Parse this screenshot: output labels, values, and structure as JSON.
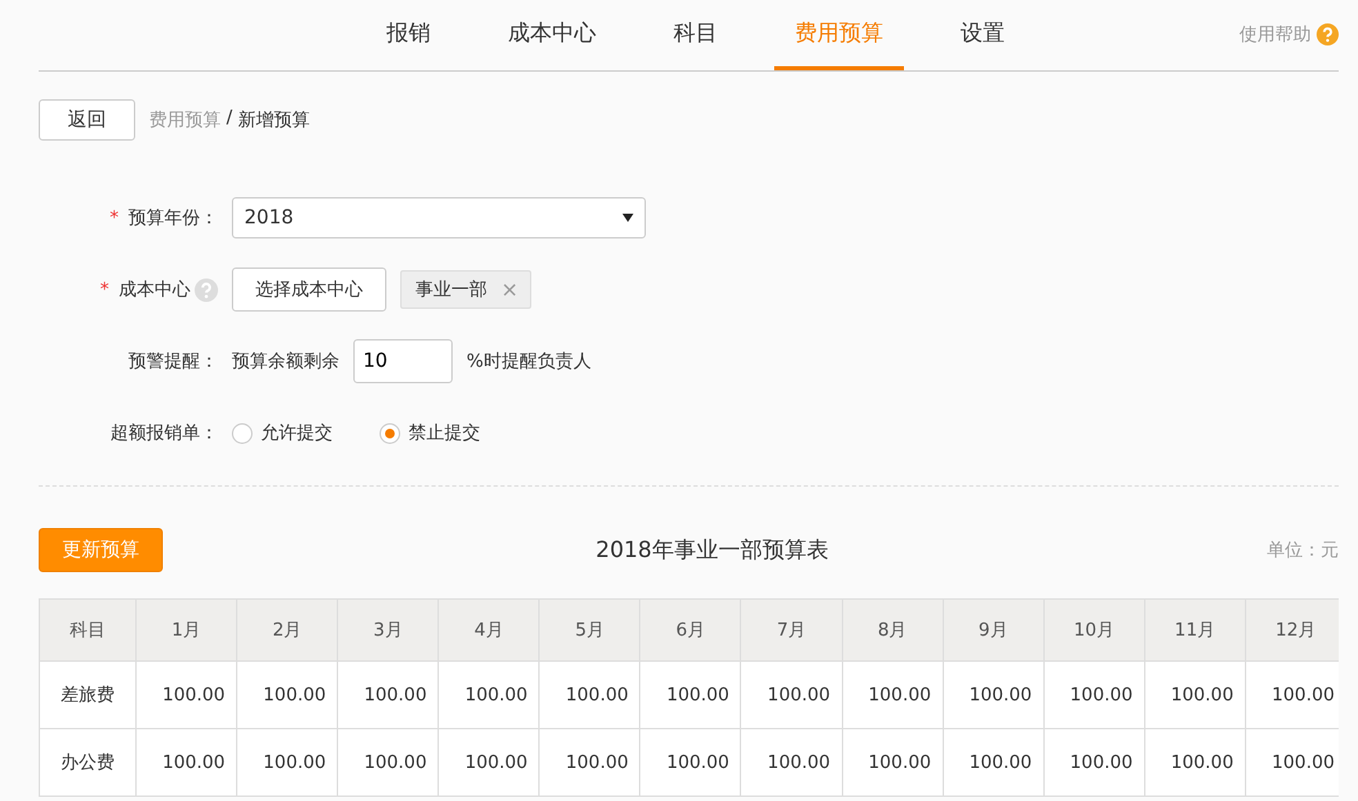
{
  "nav": {
    "tabs": [
      {
        "label": "报销",
        "selected": false
      },
      {
        "label": "成本中心",
        "selected": false
      },
      {
        "label": "科目",
        "selected": false
      },
      {
        "label": "费用预算",
        "selected": true
      },
      {
        "label": "设置",
        "selected": false
      }
    ],
    "help": "使用帮助"
  },
  "toolbar": {
    "back_button": "返回",
    "breadcrumb": {
      "parent": "费用预算",
      "separator": "/",
      "current": "新增预算"
    }
  },
  "form": {
    "fields": [
      {
        "kind": "select",
        "required_mark": "*",
        "label": "预算年份：",
        "value": "2018"
      },
      {
        "kind": "picker",
        "required_mark": "*",
        "label": "成本中心",
        "button": "选择成本中心",
        "tags": [
          {
            "label": "事业一部",
            "remove": "×"
          }
        ]
      },
      {
        "kind": "threshold",
        "label": "预警提醒：",
        "prefix": "预算余额剩余",
        "value": "10",
        "suffix": "%时提醒负责人"
      },
      {
        "kind": "radio",
        "label": "超额报销单：",
        "options": [
          {
            "label": "允许提交",
            "selected": false
          },
          {
            "label": "禁止提交",
            "selected": true
          }
        ]
      }
    ]
  },
  "budget": {
    "update_button": "更新预算",
    "title": "2018年事业一部预算表",
    "unit": "单位：元",
    "table": {
      "columns": [
        "科目",
        "1月",
        "2月",
        "3月",
        "4月",
        "5月",
        "6月",
        "7月",
        "8月",
        "9月",
        "10月",
        "11月",
        "12月"
      ],
      "rows": [
        [
          "差旅费",
          "100.00",
          "100.00",
          "100.00",
          "100.00",
          "100.00",
          "100.00",
          "100.00",
          "100.00",
          "100.00",
          "100.00",
          "100.00",
          "100.00"
        ],
        [
          "办公费",
          "100.00",
          "100.00",
          "100.00",
          "100.00",
          "100.00",
          "100.00",
          "100.00",
          "100.00",
          "100.00",
          "100.00",
          "100.00",
          "100.00"
        ]
      ]
    }
  }
}
